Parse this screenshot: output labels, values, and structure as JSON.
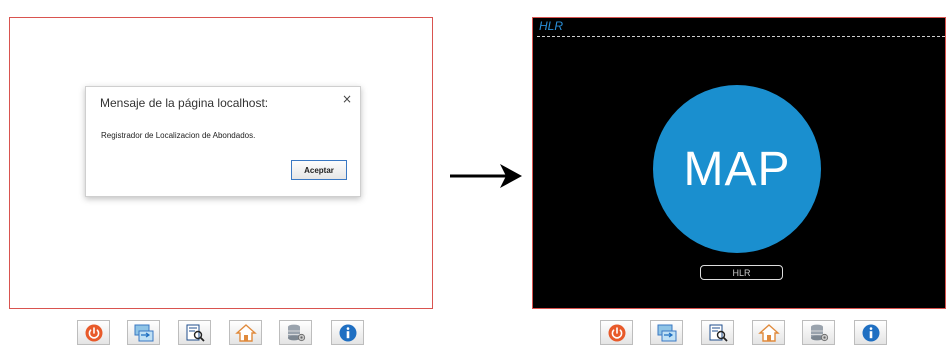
{
  "left_panel": {
    "dialog": {
      "title": "Mensaje de la página localhost:",
      "close_symbol": "×",
      "message": "Registrador de Localizacion de Abondados.",
      "button_label": "Aceptar"
    }
  },
  "right_panel": {
    "title": "HLR",
    "circle_label": "MAP",
    "button_label": "HLR"
  },
  "toolbar_icons": [
    "power-icon",
    "transfer-icon",
    "search-document-icon",
    "home-icon",
    "database-settings-icon",
    "info-icon"
  ],
  "colors": {
    "panel_border": "#d9534f",
    "map_circle": "#1a8fcf",
    "hlr_title": "#2a8fd8",
    "power_red": "#e85a2a",
    "info_blue": "#1f6fc2"
  }
}
